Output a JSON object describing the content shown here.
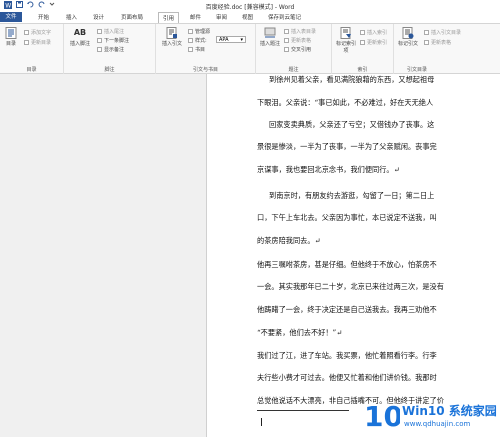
{
  "titlebar": {
    "title": "百度经验.doc [兼容模式] - Word",
    "quick_icons": [
      "word-icon",
      "save-icon",
      "undo-icon",
      "redo-icon",
      "customize-icon"
    ]
  },
  "tabs": [
    "文件",
    "开始",
    "插入",
    "设计",
    "页面布局",
    "引用",
    "邮件",
    "审阅",
    "视图",
    "保存到云笔记"
  ],
  "ribbon": {
    "toc": {
      "big": "目录",
      "small": [
        "添加文字",
        "更新目录"
      ],
      "label": "目录"
    },
    "footnote": {
      "big": "插入脚注",
      "big_icon_text": "AB",
      "small": [
        "插入尾注",
        "下一条脚注",
        "显示备注"
      ],
      "label": "脚注"
    },
    "citation": {
      "big": "插入引文",
      "small": [
        "管理源",
        "样式:",
        "书目"
      ],
      "style_value": "APA",
      "label": "引文与书目"
    },
    "caption": {
      "big": "插入题注",
      "small": [
        "插入表目录",
        "更新表格",
        "交叉引用"
      ],
      "label": "题注"
    },
    "index": {
      "big": "标记索引项",
      "small": [
        "插入索引",
        "更新索引"
      ],
      "label": "索引"
    },
    "authorities": {
      "big": "标记引文",
      "small": [
        "插入引文目录",
        "更新表格"
      ],
      "label": "引文目录"
    }
  },
  "document": {
    "lines": [
      {
        "text": "到徐州见着父亲，看见满院狼藉的东西，又想起祖母",
        "indent": true
      },
      {
        "text": "下眼泪。父亲说：“事已如此，不必难过，好在天无绝人",
        "indent": false
      },
      {
        "text": "回家变卖典质，父亲还了亏空；又借钱办了丧事。这",
        "indent": true
      },
      {
        "text": "景很是惨淡，一半为了丧事，一半为了父亲赋闲。丧事完",
        "indent": false
      },
      {
        "text": "京谋事，我也要回北京念书，我们便同行。↵",
        "indent": false
      },
      {
        "text": "到南京时，有朋友约去游逛，勾留了一日；第二日上",
        "indent": true
      },
      {
        "text": "口，下午上车北去。父亲因为事忙，本已说定不送我，叫",
        "indent": false
      },
      {
        "text": "的茶房陪我同去。↵",
        "indent": false
      },
      {
        "text": "他再三嘱咐茶房，甚是仔细。但他终于不放心，怕茶房不",
        "indent": false
      },
      {
        "text": "一会。其实我那年已二十岁，北京已来往过两三次，是没有",
        "indent": false
      },
      {
        "text": "他踌躇了一会，终于决定还是自己送我去。我再三劝他不",
        "indent": false
      },
      {
        "text": "“不要紧，他们去不好！”↵",
        "indent": false
      },
      {
        "text": "我们过了江，进了车站。我买票，他忙着照看行李。行李",
        "indent": false
      },
      {
        "text": "夫行些小费才可过去。他便又忙着和他们讲价钱。我那时",
        "indent": false
      },
      {
        "text": "总觉他说话不大漂亮，非自己插嘴不可。但他终于讲定了价",
        "indent": false
      }
    ]
  },
  "watermark": {
    "brand": "Win10 系统家园",
    "url": "www.qdhuajin.com",
    "colors": {
      "logo": "#1a73d9",
      "text": "#1a73d9"
    }
  }
}
